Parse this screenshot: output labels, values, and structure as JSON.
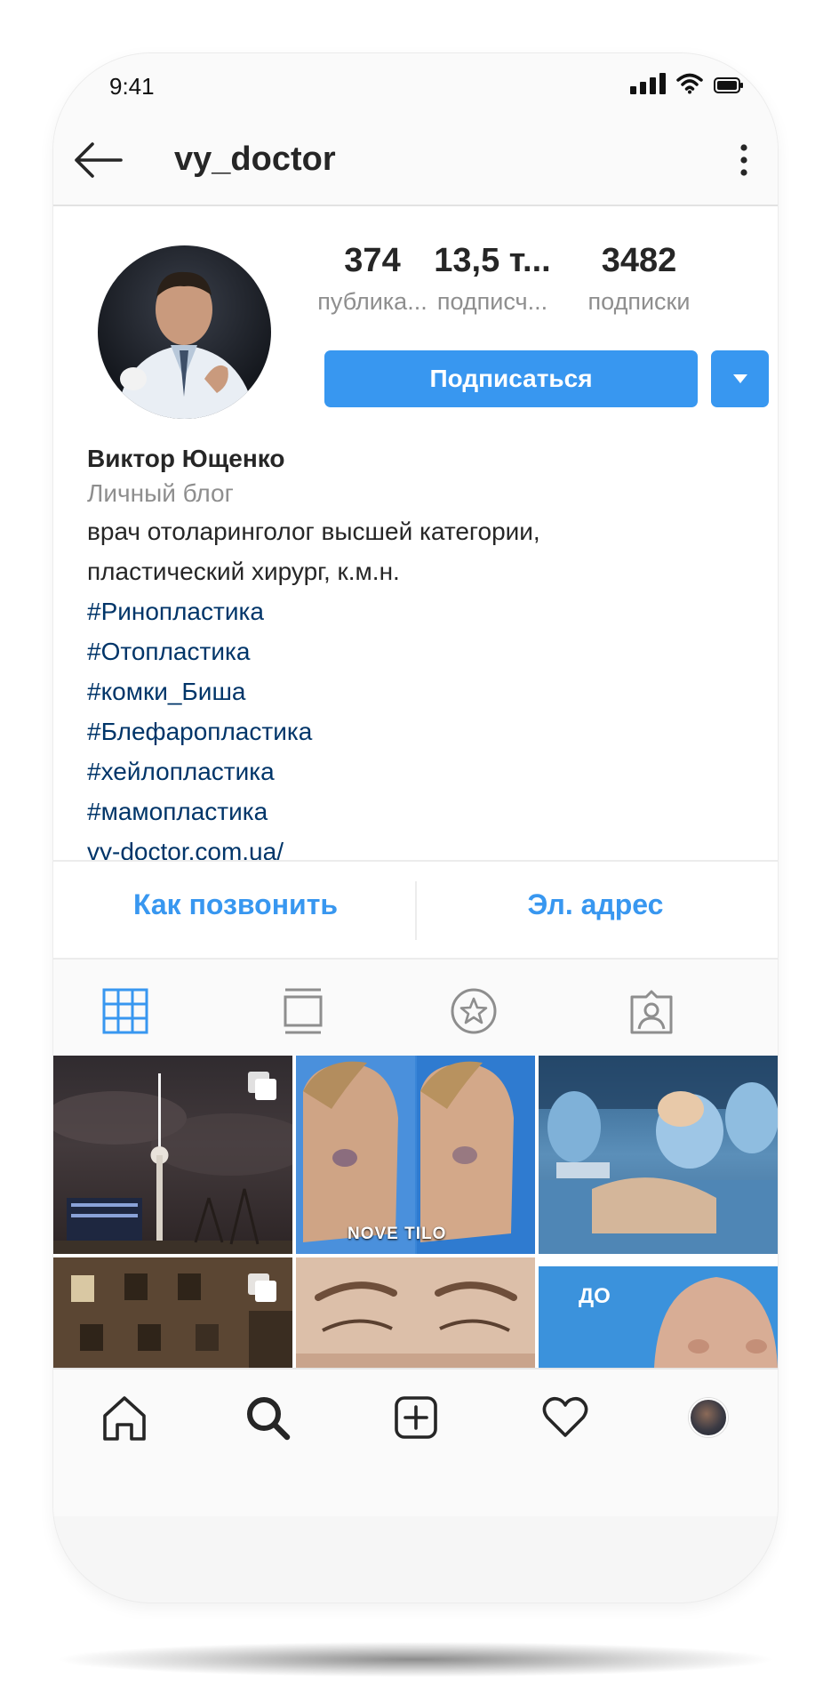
{
  "status_bar": {
    "time": "9:41"
  },
  "header": {
    "username": "vy_doctor"
  },
  "profile": {
    "stats": [
      {
        "value": "374",
        "label": "публика..."
      },
      {
        "value": "13,5 т...",
        "label": "подписч..."
      },
      {
        "value": "3482",
        "label": "подписки"
      }
    ],
    "follow_label": "Подписаться",
    "bio": {
      "name": "Виктор Ющенко",
      "category": "Личный блог",
      "description": [
        "врач отоларинголог высшей категории,",
        "пластический хирург, к.м.н."
      ],
      "hashtags": [
        "#Ринопластика",
        "#Отопластика",
        "#комки_Биша",
        "#Блефаропластика",
        "#хейлопластика",
        "#мамопластика"
      ],
      "link": "vy-doctor.com.ua/"
    }
  },
  "contact": {
    "call_label": "Как позвонить",
    "email_label": "Эл. адрес"
  },
  "tabs": [
    {
      "icon": "grid-icon",
      "active": true
    },
    {
      "icon": "feed-icon",
      "active": false
    },
    {
      "icon": "star-icon",
      "active": false
    },
    {
      "icon": "tagged-icon",
      "active": false
    }
  ],
  "grid": {
    "posts": [
      {
        "subject": "tv-tower-night",
        "multi": true
      },
      {
        "subject": "face-before-after",
        "multi": false,
        "overlay_text": "NOVE TILO"
      },
      {
        "subject": "surgery-team",
        "multi": false
      },
      {
        "subject": "building-night",
        "multi": true
      },
      {
        "subject": "eyes-closeup",
        "multi": false
      },
      {
        "subject": "before-torso",
        "multi": false,
        "overlay_text": "ДО"
      }
    ]
  },
  "bottom_nav": [
    "home-icon",
    "search-icon",
    "add-post-icon",
    "heart-icon",
    "profile-avatar"
  ],
  "colors": {
    "accent": "#3897f0",
    "hashtag": "#003569",
    "muted": "#8e8e8e",
    "text": "#262626"
  }
}
